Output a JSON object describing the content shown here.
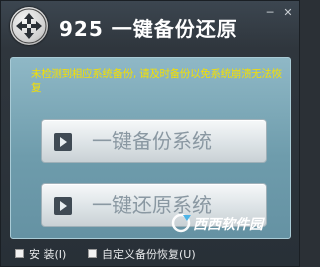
{
  "window": {
    "title": "925 一键备份还原",
    "minimize_glyph": "─",
    "close_glyph": "✕"
  },
  "notice": {
    "text": "未检测到相应系统备份, 请及时备份以免系统崩溃无法恢复"
  },
  "buttons": {
    "backup_label": "一键备份系统",
    "restore_label": "一键还原系统"
  },
  "footer": {
    "install_label": "安 装(I)",
    "custom_label": "自定义备份恢复(U)"
  },
  "watermark": {
    "text": "西西软件园"
  },
  "colors": {
    "notice": "#f5e000",
    "panel": "#7aa7b8",
    "background": "#2f363d"
  }
}
